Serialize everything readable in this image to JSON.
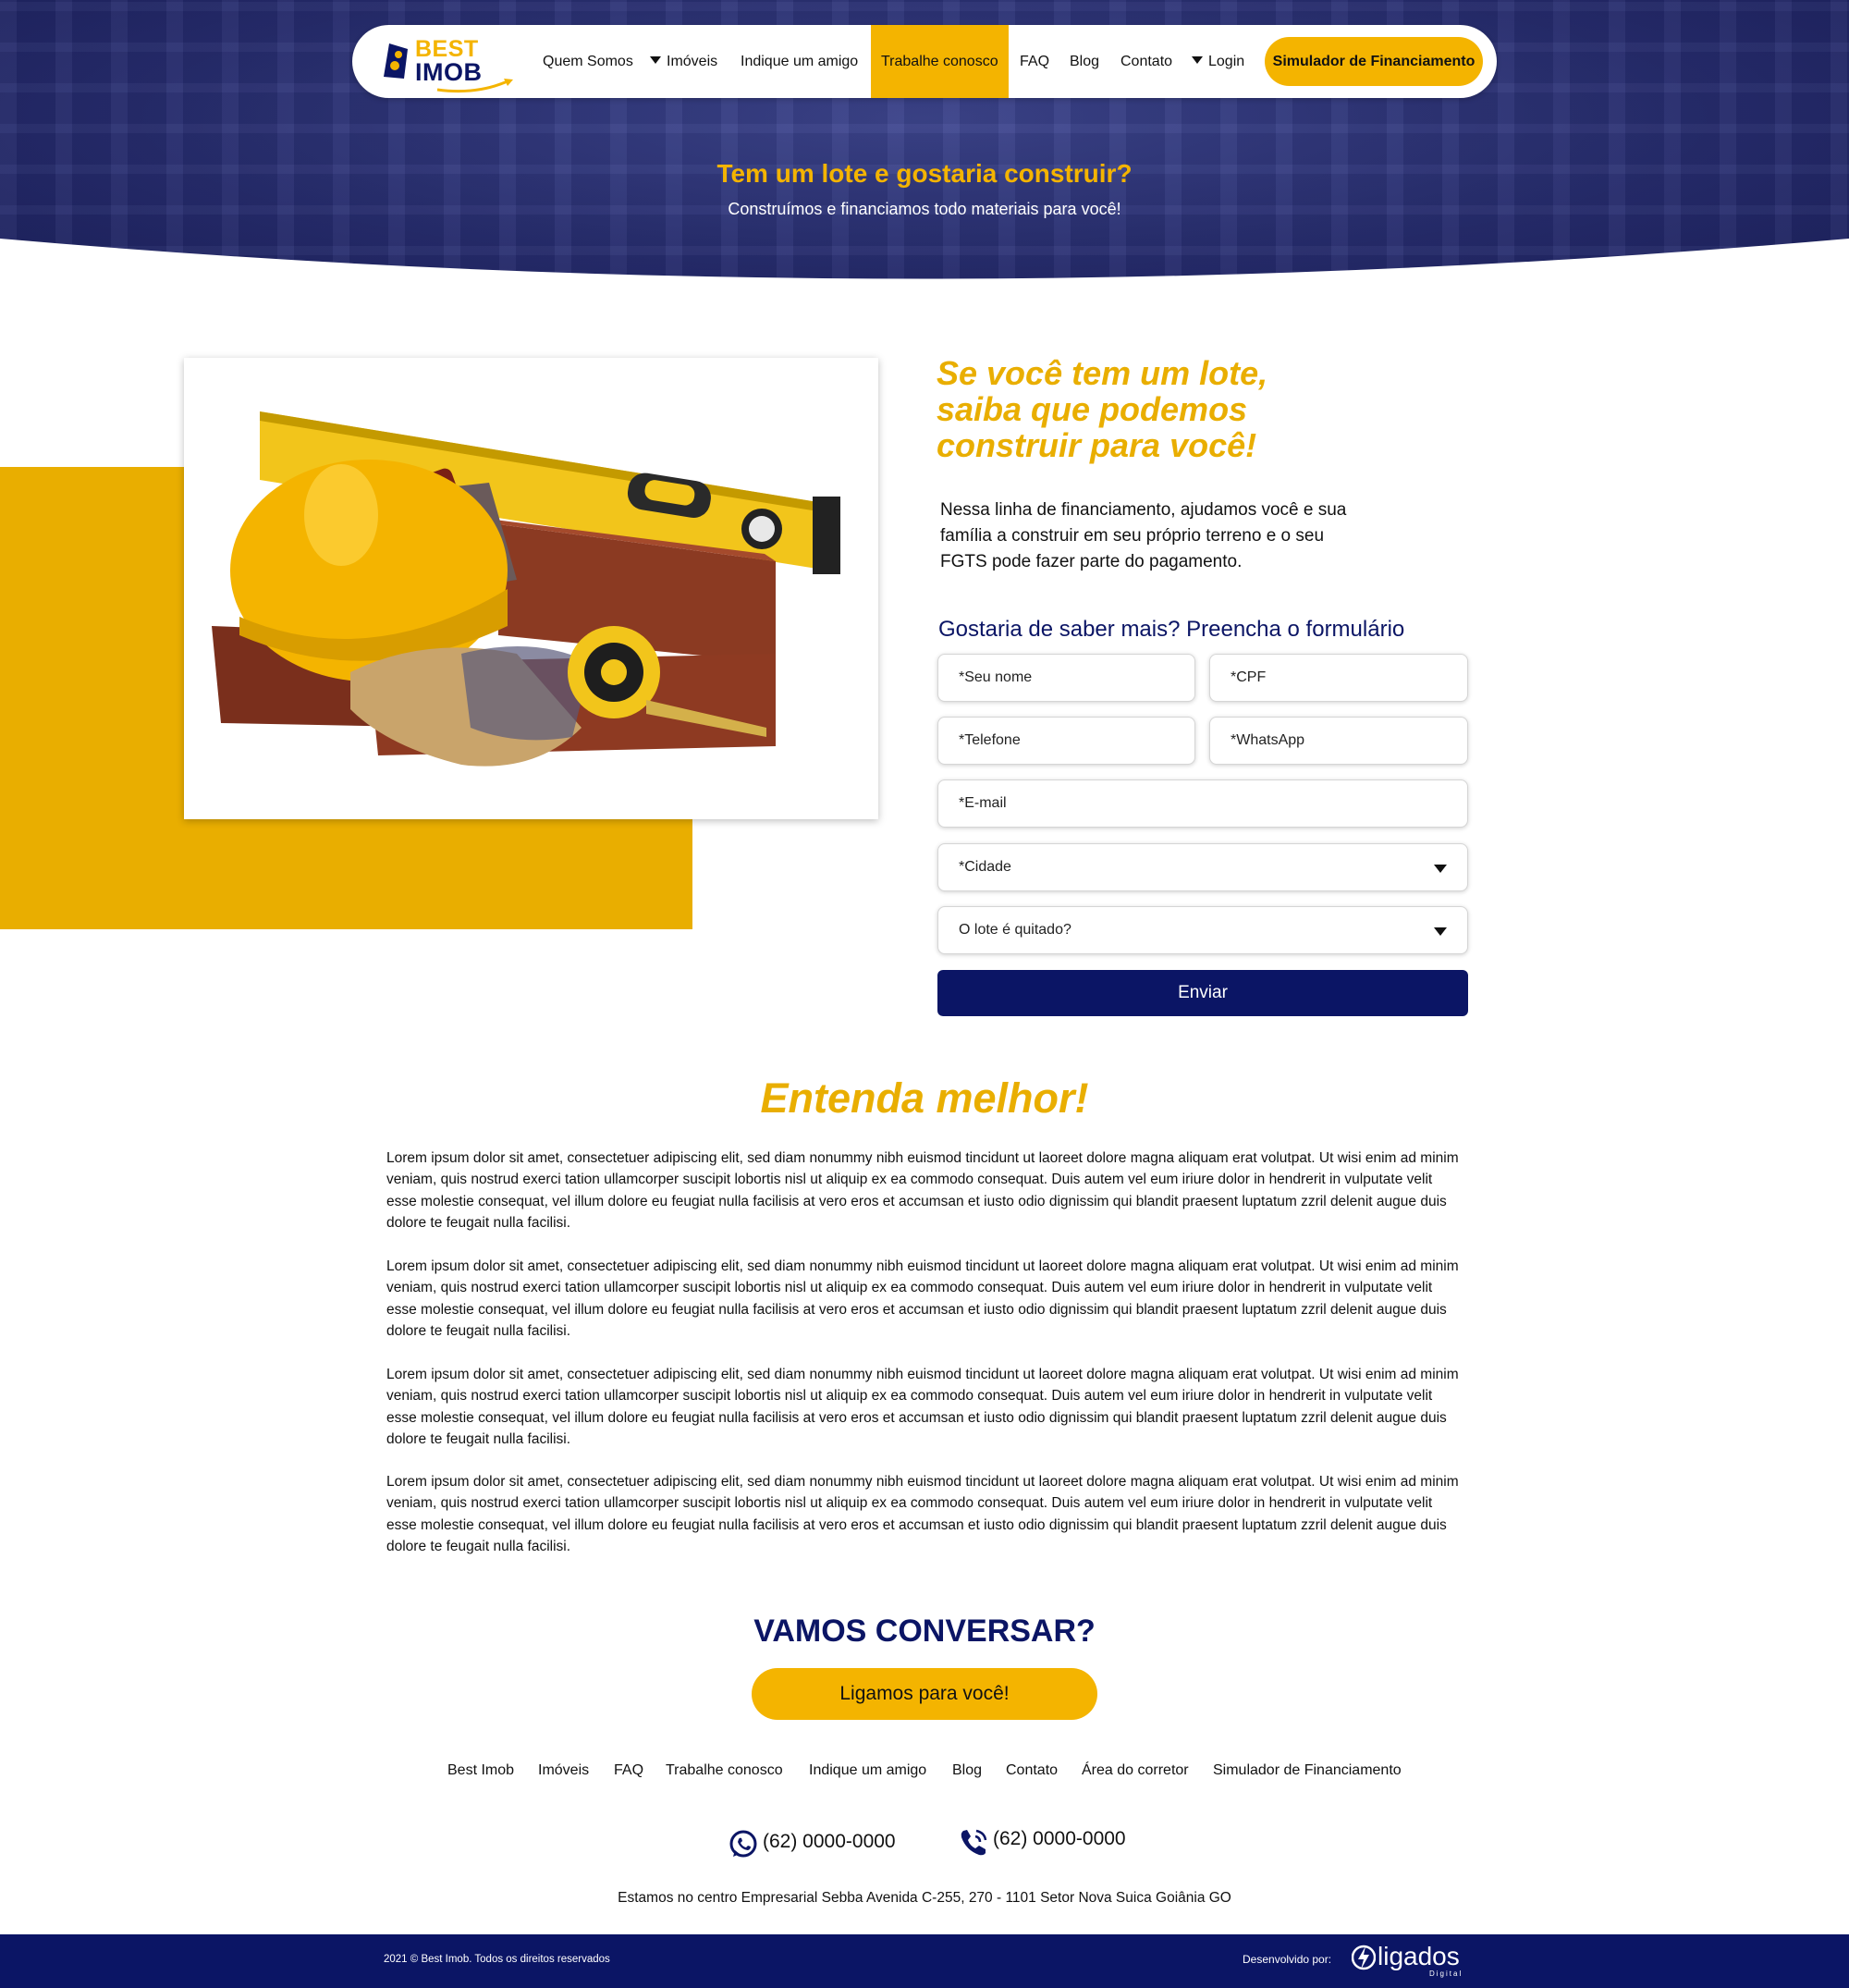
{
  "colors": {
    "navy": "#0b1565",
    "yellow": "#f4b400",
    "gold": "#e9ae00",
    "hero": "#272d70"
  },
  "brand": {
    "best": "BEST",
    "imob": "IMOB"
  },
  "nav": {
    "items": [
      "Quem Somos",
      "Imóveis",
      "Indique um amigo",
      "Trabalhe conosco",
      "FAQ",
      "Blog",
      "Contato",
      "Login"
    ],
    "cta": "Simulador de Financiamento"
  },
  "hero": {
    "title": "Tem um lote e gostaria construir?",
    "subtitle": "Construímos e financiamos todo materiais para você!"
  },
  "pitch": {
    "title_lines": [
      "Se você tem um lote,",
      "saiba que podemos",
      "construir para você!"
    ],
    "text": "Nessa linha de financiamento, ajudamos você e sua família a construir em seu próprio terreno e o seu FGTS pode fazer parte do pagamento."
  },
  "form": {
    "title": "Gostaria de saber mais? Preencha o formulário",
    "name": "*Seu nome",
    "cpf": "*CPF",
    "phone": "*Telefone",
    "whatsapp": "*WhatsApp",
    "email": "*E-mail",
    "city": "*Cidade",
    "lot_paid": "O lote é quitado?",
    "submit": "Enviar"
  },
  "entenda": {
    "title": "Entenda melhor!",
    "paragraphs": [
      "Lorem ipsum dolor sit amet, consectetuer adipiscing elit, sed diam nonummy nibh euismod tincidunt ut laoreet dolore magna aliquam erat volutpat. Ut wisi enim ad minim veniam, quis nostrud exerci tation ullamcorper suscipit lobortis nisl ut aliquip ex ea commodo consequat. Duis autem vel eum iriure dolor in hendrerit in vulputate velit esse molestie consequat, vel illum dolore eu feugiat nulla facilisis at vero eros et accumsan et iusto odio dignissim qui blandit praesent luptatum zzril delenit augue duis dolore te feugait nulla facilisi.",
      "Lorem ipsum dolor sit amet, consectetuer adipiscing elit, sed diam nonummy nibh euismod tincidunt ut laoreet dolore magna aliquam erat volutpat. Ut wisi enim ad minim veniam, quis nostrud exerci tation ullamcorper suscipit lobortis nisl ut aliquip ex ea commodo consequat. Duis autem vel eum iriure dolor in hendrerit in vulputate velit esse molestie consequat, vel illum dolore eu feugiat nulla facilisis at vero eros et accumsan et iusto odio dignissim qui blandit praesent luptatum zzril delenit augue duis dolore te feugait nulla facilisi.",
      "Lorem ipsum dolor sit amet, consectetuer adipiscing elit, sed diam nonummy nibh euismod tincidunt ut laoreet dolore magna aliquam erat volutpat. Ut wisi enim ad minim veniam, quis nostrud exerci tation ullamcorper suscipit lobortis nisl ut aliquip ex ea commodo consequat. Duis autem vel eum iriure dolor in hendrerit in vulputate velit esse molestie consequat, vel illum dolore eu feugiat nulla facilisis at vero eros et accumsan et iusto odio dignissim qui blandit praesent luptatum zzril delenit augue duis dolore te feugait nulla facilisi.",
      "Lorem ipsum dolor sit amet, consectetuer adipiscing elit, sed diam nonummy nibh euismod tincidunt ut laoreet dolore magna aliquam erat volutpat. Ut wisi enim ad minim veniam, quis nostrud exerci tation ullamcorper suscipit lobortis nisl ut aliquip ex ea commodo consequat. Duis autem vel eum iriure dolor in hendrerit in vulputate velit esse molestie consequat, vel illum dolore eu feugiat nulla facilisis at vero eros et accumsan et iusto odio dignissim qui blandit praesent luptatum zzril delenit augue duis dolore te feugait nulla facilisi."
    ]
  },
  "contact": {
    "title": "VAMOS CONVERSAR?",
    "call_button": "Ligamos para você!",
    "whatsapp_phone": "(62) 0000-0000",
    "phone": "(62) 0000-0000",
    "address": "Estamos no centro Empresarial Sebba Avenida C-255, 270 - 1101 Setor Nova Suica Goiânia GO"
  },
  "footer": {
    "links": [
      "Best Imob",
      "Imóveis",
      "FAQ",
      "Trabalhe conosco",
      "Indique um amigo",
      "Blog",
      "Contato",
      "Área do corretor",
      "Simulador de Financiamento"
    ],
    "copyright": "2021 © Best Imob. Todos os direitos reservados",
    "developed_by": "Desenvolvido por:",
    "dev_name": "ligados",
    "dev_sub": "Digital"
  }
}
